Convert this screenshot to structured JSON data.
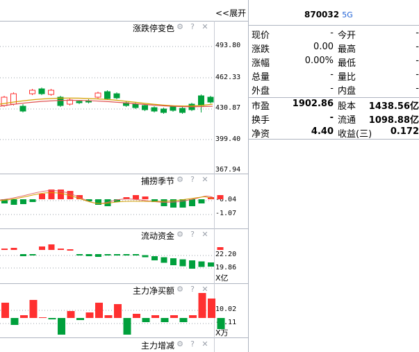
{
  "left": {
    "expand_label": "<<展开",
    "panels": [
      {
        "title": "涨跌停变色",
        "axis": [
          "493.80",
          "462.33",
          "430.87",
          "399.40",
          "367.94"
        ]
      },
      {
        "title": "捕捞季节",
        "axis": [
          "-0.04",
          "-1.07"
        ]
      },
      {
        "title": "流动资金",
        "axis": [
          "22.20",
          "19.86"
        ],
        "unit": "X亿"
      },
      {
        "title": "主力净买额",
        "axis": [
          "10.02",
          "-6.11"
        ],
        "unit": "X万"
      },
      {
        "title": "主力增减",
        "axis": []
      }
    ],
    "controls": {
      "gear": "⚙",
      "help": "?",
      "close": "✕"
    }
  },
  "right": {
    "code": "870032",
    "tag": "5G",
    "rows": [
      {
        "l1": "现价",
        "v1": "-",
        "l2": "今开",
        "v2": "-"
      },
      {
        "l1": "涨跌",
        "v1": "0.00",
        "l2": "最高",
        "v2": "-"
      },
      {
        "l1": "涨幅",
        "v1": "0.00%",
        "l2": "最低",
        "v2": "-"
      },
      {
        "l1": "总量",
        "v1": "-",
        "l2": "量比",
        "v2": "-"
      },
      {
        "l1": "外盘",
        "v1": "-",
        "l2": "内盘",
        "v2": "-"
      },
      {
        "l1": "市盈",
        "v1": "1902.86",
        "l2": "股本",
        "v2": "1438.56亿"
      },
      {
        "l1": "换手",
        "v1": "-",
        "l2": "流通",
        "v2": "1098.88亿"
      },
      {
        "l1": "净资",
        "v1": "4.40",
        "l2": "收益(三)",
        "v2": "0.172"
      }
    ]
  },
  "colors": {
    "up": "#ff3030",
    "down": "#00a03c",
    "ma1": "#d4a000",
    "ma2": "#e05050",
    "border": "#aeb4c0"
  }
}
